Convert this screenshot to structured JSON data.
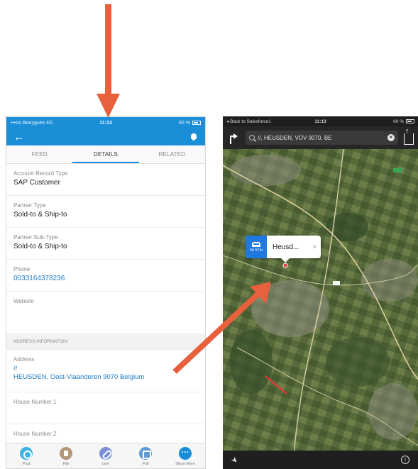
{
  "left_phone": {
    "status": {
      "carrier": "•••oo Bouygues 4G",
      "time": "11:13",
      "battery": "60 %"
    },
    "tabs": [
      {
        "label": "FEED"
      },
      {
        "label": "DETAILS"
      },
      {
        "label": "RELATED"
      }
    ],
    "fields": {
      "account_record_type": {
        "label": "Account Record Type",
        "value": "SAP Customer"
      },
      "partner_type": {
        "label": "Partner Type",
        "value": "Sold-to & Ship-to"
      },
      "partner_sub_type": {
        "label": "Partner Sub-Type",
        "value": "Sold-to & Ship-to"
      },
      "phone": {
        "label": "Phone",
        "value": "0033164378236"
      },
      "website": {
        "label": "Website",
        "value": ""
      }
    },
    "address_section": "ADDRESS INFORMATION",
    "address": {
      "label": "Address",
      "line1": "//",
      "line2": "HEUSDEN, Oost-Vlaanderen 9070 Belgium"
    },
    "house_number_1": {
      "label": "House Number 1"
    },
    "house_number_2": {
      "label": "House Number 2"
    },
    "actions": [
      {
        "label": "Post",
        "icon": "post-icon"
      },
      {
        "label": "File",
        "icon": "file-icon"
      },
      {
        "label": "Link",
        "icon": "link-icon"
      },
      {
        "label": "Poll",
        "icon": "poll-icon"
      },
      {
        "label": "Show More",
        "icon": "more-icon"
      }
    ]
  },
  "right_phone": {
    "status": {
      "back": "◂ Back to Salesforce1",
      "time": "11:13",
      "battery": "60 %"
    },
    "search_query": "//, HEUSDEN, VOV 9070, BE",
    "callout": {
      "duration": "6h 57m",
      "name": "Heusd...",
      "chevron": ">"
    }
  },
  "colors": {
    "salesforce_blue": "#1a8fd8",
    "arrow": "#e8613c",
    "map_pin": "#e53935"
  }
}
